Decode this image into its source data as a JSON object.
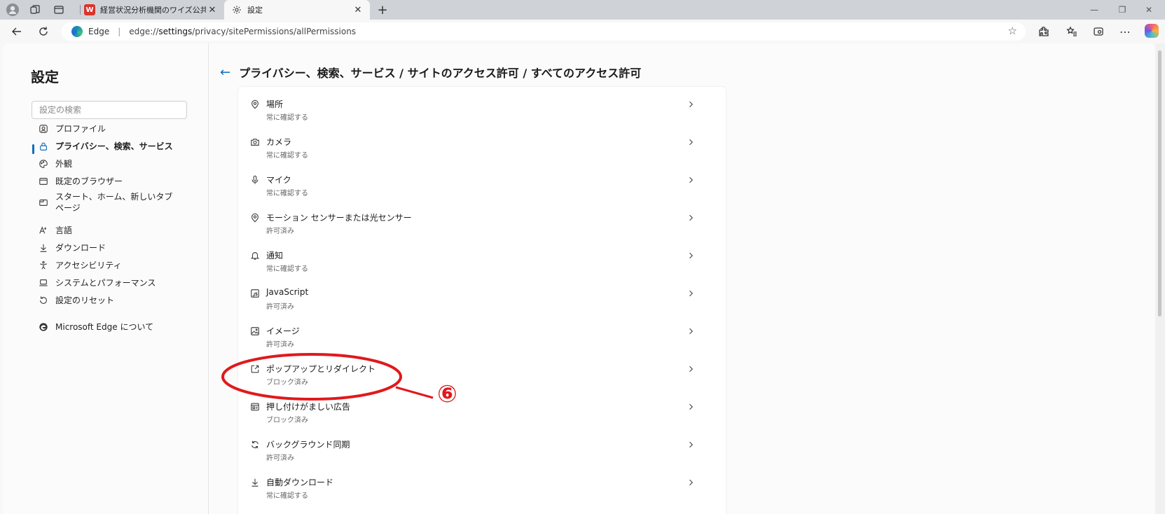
{
  "browser": {
    "tabs": [
      {
        "title": "経営状況分析機関のワイズ公共デー",
        "favicon": "W",
        "favicon_color": "#d9342b",
        "active": false
      },
      {
        "title": "設定",
        "favicon": "gear-icon",
        "active": true
      }
    ],
    "address": {
      "brand": "Edge",
      "url_scheme": "edge://",
      "url_host": "settings",
      "url_path": "/privacy/sitePermissions/allPermissions"
    }
  },
  "sidebar": {
    "title": "設定",
    "search_placeholder": "設定の検索",
    "items": [
      {
        "label": "プロファイル",
        "icon": "profile-icon",
        "active": false
      },
      {
        "label": "プライバシー、検索、サービス",
        "icon": "lock-icon",
        "active": true
      },
      {
        "label": "外観",
        "icon": "appearance-icon",
        "active": false
      },
      {
        "label": "既定のブラウザー",
        "icon": "browser-icon",
        "active": false
      },
      {
        "label": "スタート、ホーム、新しいタブ ページ",
        "icon": "home-tab-icon",
        "active": false
      },
      {
        "label": "言語",
        "icon": "language-icon",
        "active": false
      },
      {
        "label": "ダウンロード",
        "icon": "download-icon",
        "active": false
      },
      {
        "label": "アクセシビリティ",
        "icon": "accessibility-icon",
        "active": false
      },
      {
        "label": "システムとパフォーマンス",
        "icon": "system-icon",
        "active": false
      },
      {
        "label": "設定のリセット",
        "icon": "reset-icon",
        "active": false
      },
      {
        "label": "Microsoft Edge について",
        "icon": "edge-logo-icon",
        "active": false
      }
    ]
  },
  "breadcrumb": "プライバシー、検索、サービス / サイトのアクセス許可 / すべてのアクセス許可",
  "permissions": [
    {
      "label": "場所",
      "status": "常に確認する",
      "icon": "location-icon"
    },
    {
      "label": "カメラ",
      "status": "常に確認する",
      "icon": "camera-icon"
    },
    {
      "label": "マイク",
      "status": "常に確認する",
      "icon": "microphone-icon"
    },
    {
      "label": "モーション センサーまたは光センサー",
      "status": "許可済み",
      "icon": "sensor-icon"
    },
    {
      "label": "通知",
      "status": "常に確認する",
      "icon": "bell-icon"
    },
    {
      "label": "JavaScript",
      "status": "許可済み",
      "icon": "javascript-icon"
    },
    {
      "label": "イメージ",
      "status": "許可済み",
      "icon": "image-icon"
    },
    {
      "label": "ポップアップとリダイレクト",
      "status": "ブロック済み",
      "icon": "popup-icon"
    },
    {
      "label": "押し付けがましい広告",
      "status": "ブロック済み",
      "icon": "ads-icon"
    },
    {
      "label": "バックグラウンド同期",
      "status": "許可済み",
      "icon": "sync-icon"
    },
    {
      "label": "自動ダウンロード",
      "status": "常に確認する",
      "icon": "download-icon"
    }
  ],
  "annotation": {
    "label": "⑥",
    "color": "#e0191c"
  },
  "colors": {
    "accent": "#0f6cbd",
    "annotation": "#e0191c"
  }
}
